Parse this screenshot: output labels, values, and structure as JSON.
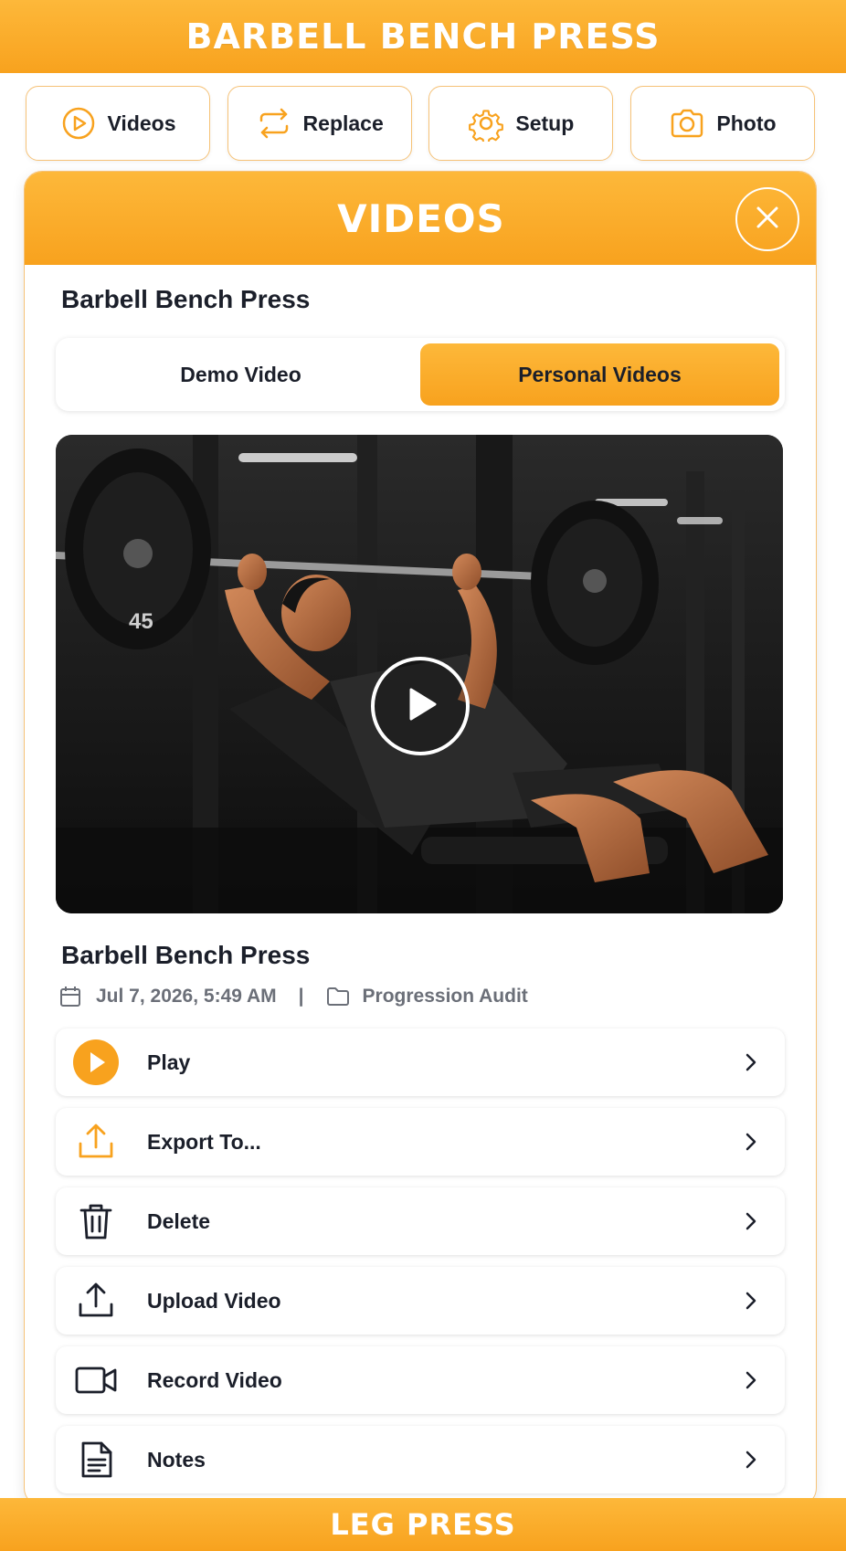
{
  "header": {
    "title": "BARBELL BENCH PRESS"
  },
  "toolbar": {
    "videos_label": "Videos",
    "replace_label": "Replace",
    "setup_label": "Setup",
    "photo_label": "Photo"
  },
  "modal": {
    "title": "VIDEOS",
    "exercise_name": "Barbell Bench Press",
    "tabs": [
      {
        "label": "Demo Video",
        "active": false
      },
      {
        "label": "Personal Videos",
        "active": true
      }
    ],
    "video": {
      "title": "Barbell Bench Press",
      "date": "Jul 7, 2026, 5:49 AM",
      "separator": "|",
      "folder": "Progression Audit",
      "plate_label": "45"
    },
    "actions": [
      {
        "label": "Play",
        "icon": "play-circle-icon"
      },
      {
        "label": "Export To...",
        "icon": "export-icon"
      },
      {
        "label": "Delete",
        "icon": "trash-icon"
      },
      {
        "label": "Upload Video",
        "icon": "upload-icon"
      },
      {
        "label": "Record Video",
        "icon": "video-camera-icon"
      },
      {
        "label": "Notes",
        "icon": "notes-icon"
      }
    ]
  },
  "footer": {
    "next_exercise": "LEG PRESS"
  },
  "colors": {
    "accent": "#F8A21E",
    "accent_light": "#FDB83A",
    "text": "#1B1F2A",
    "muted": "#6B6F78"
  }
}
